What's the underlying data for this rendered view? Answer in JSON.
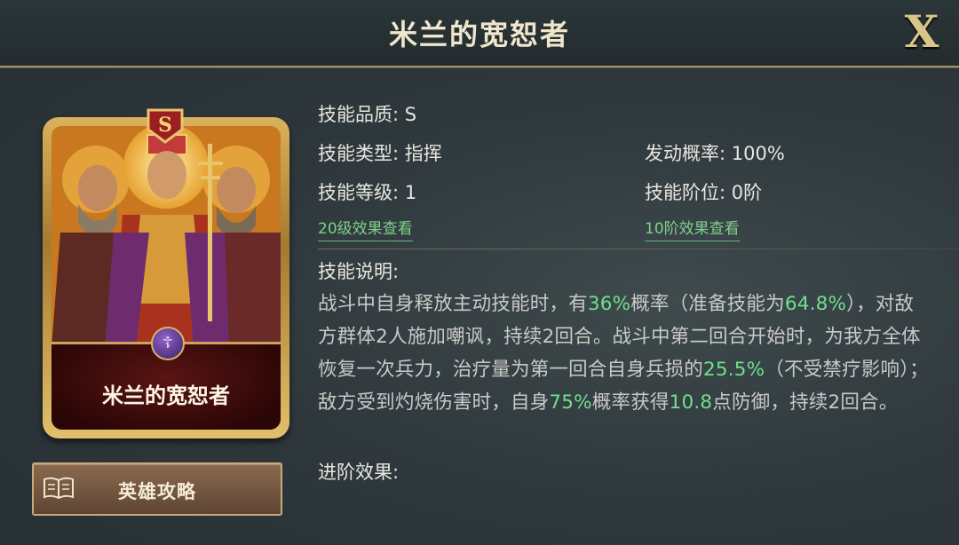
{
  "title": "米兰的宽恕者",
  "close_label": "X",
  "card": {
    "name": "米兰的宽恕者",
    "grade": "S",
    "emblem": "☦"
  },
  "guide_button": {
    "label": "英雄攻略",
    "icon": "book-icon"
  },
  "attributes": {
    "quality": "技能品质: S",
    "type": "技能类型: 指挥",
    "rate": "发动概率: 100%",
    "level": "技能等级: 1",
    "tier": "技能阶位: 0阶"
  },
  "links": {
    "level20": "20级效果查看",
    "tier10": "10阶效果查看"
  },
  "description": {
    "heading": "技能说明:",
    "segments": [
      {
        "text": "战斗中自身释放主动技能时，有",
        "hl": false
      },
      {
        "text": "36%",
        "hl": true
      },
      {
        "text": "概率（准备技能为",
        "hl": false
      },
      {
        "text": "64.8%",
        "hl": true
      },
      {
        "text": "），对敌方群体2人施加嘲讽，持续2回合。战斗中第二回合开始时，为我方全体恢复一次兵力，治疗量为第一回合自身兵损的",
        "hl": false
      },
      {
        "text": "25.5%",
        "hl": true
      },
      {
        "text": "（不受禁疗影响）；敌方受到灼烧伤害时，自身",
        "hl": false
      },
      {
        "text": "75%",
        "hl": true
      },
      {
        "text": "概率获得",
        "hl": false
      },
      {
        "text": "10.8",
        "hl": true
      },
      {
        "text": "点防御，持续2回合。",
        "hl": false
      }
    ]
  },
  "advance": {
    "heading": "进阶效果:"
  },
  "colors": {
    "highlight": "#6fe08c",
    "link": "#7fcf8a",
    "gold": "#d9c489"
  }
}
